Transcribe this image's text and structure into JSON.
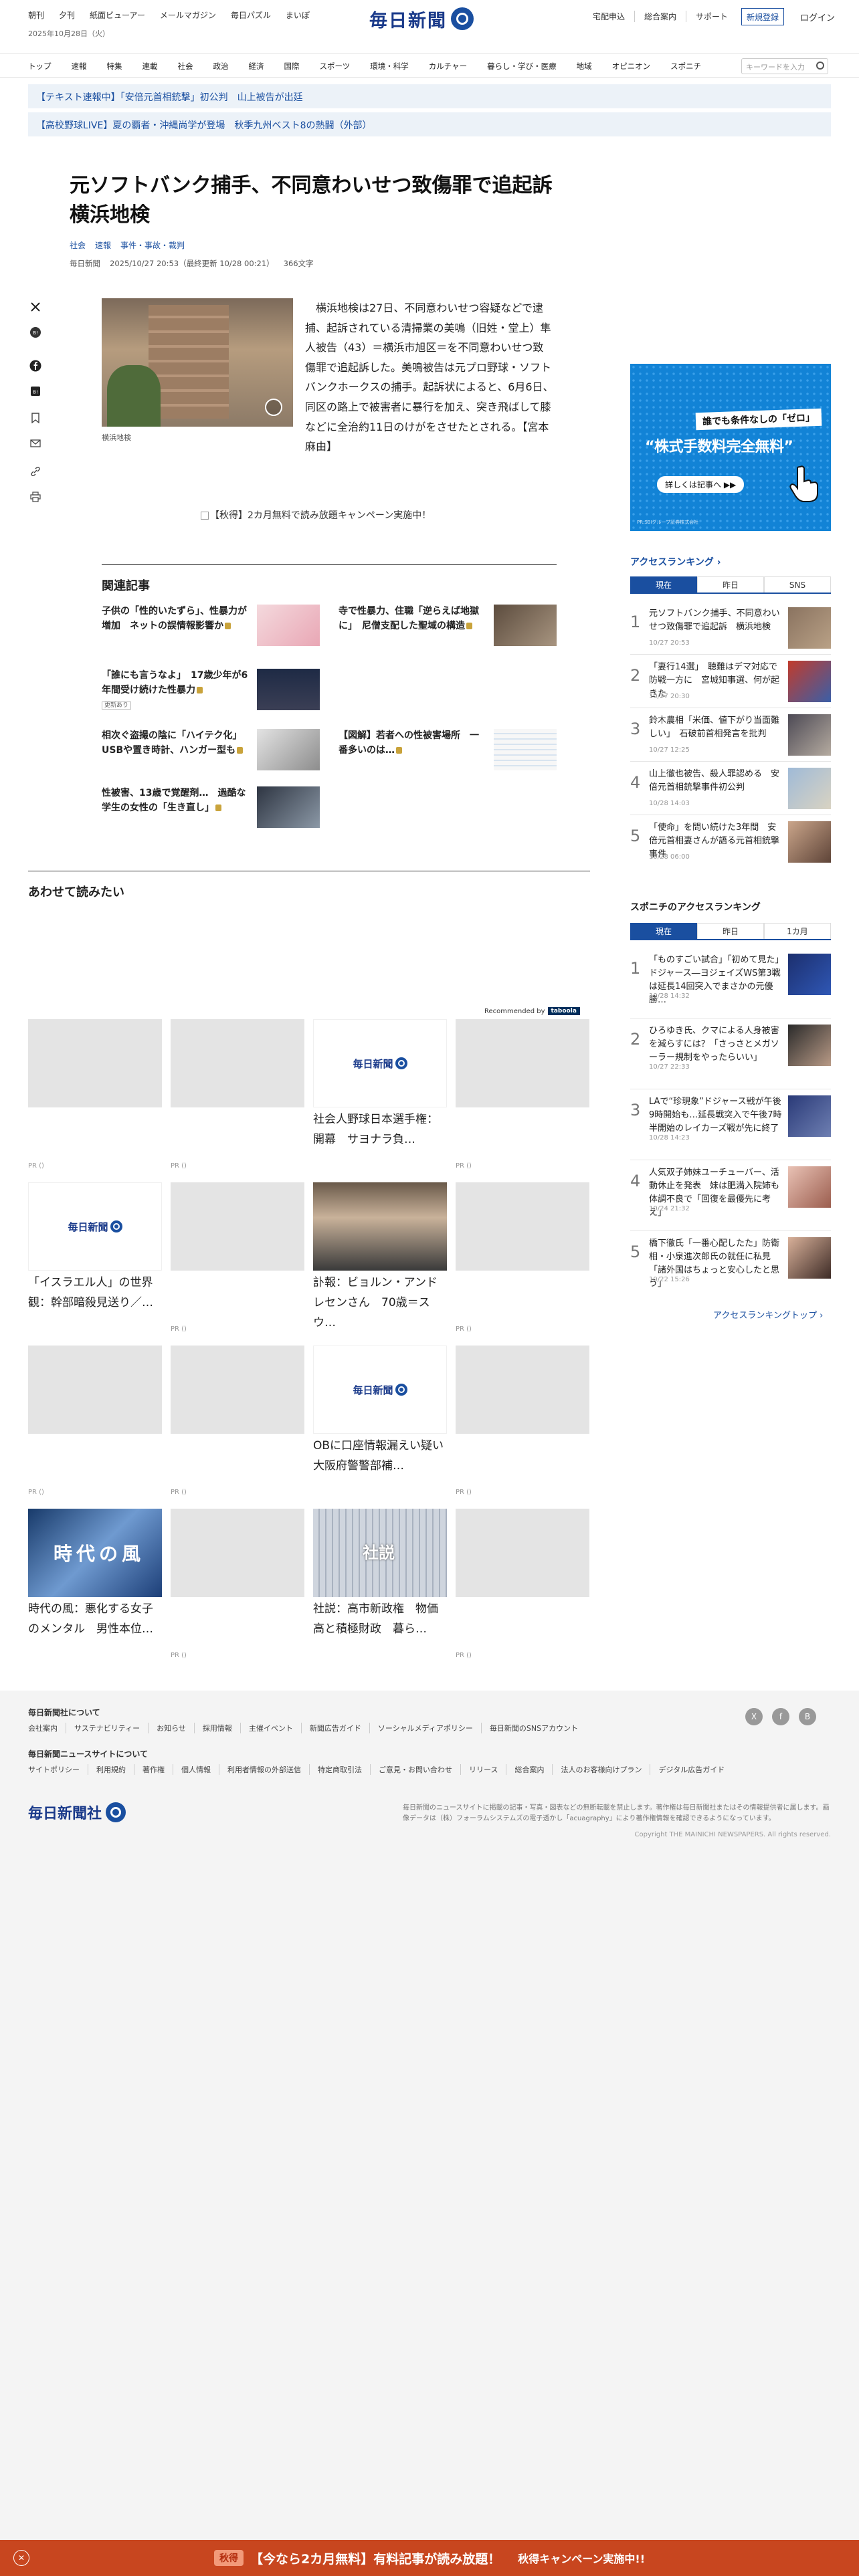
{
  "header": {
    "top_links": [
      "朝刊",
      "夕刊",
      "紙面ビューアー",
      "メールマガジン",
      "毎日パズル",
      "まいぽ"
    ],
    "date": "2025年10月28日（火）",
    "logo_text": "毎日新聞",
    "right_links": [
      "宅配申込",
      "総合案内",
      "サポート"
    ],
    "register_label": "新規登録",
    "login_label": "ログイン"
  },
  "nav": {
    "items": [
      "トップ",
      "速報",
      "特集",
      "連載",
      "社会",
      "政治",
      "経済",
      "国際",
      "スポーツ",
      "環境・科学",
      "カルチャー",
      "暮らし・学び・医療",
      "地域",
      "オピニオン",
      "スポニチ"
    ],
    "search_placeholder": "キーワードを入力"
  },
  "breaking": [
    "【テキスト速報中】「安倍元首相銃撃」初公判　山上被告が出廷",
    "【高校野球LIVE】夏の覇者・沖縄尚学が登場　秋季九州ベスト8の熱闘（外部）"
  ],
  "article": {
    "headline": "元ソフトバンク捕手、不同意わいせつ致傷罪で追起訴　横浜地検",
    "categories": [
      "社会",
      "速報",
      "事件・事故・裁判"
    ],
    "source": "毎日新聞",
    "datetime": "2025/10/27 20:53（最終更新 10/28 00:21）",
    "char_count": "366文字",
    "photo_caption": "横浜地検",
    "body": "横浜地検は27日、不同意わいせつ容疑などで逮捕、起訴されている清掃業の美鳴（旧姓・堂上）隼人被告（43）＝横浜市旭区＝を不同意わいせつ致傷罪で追起訴した。美鳴被告は元プロ野球・ソフトバンクホークスの捕手。起訴状によると、6月6日、同区の路上で被害者に暴行を加え、突き飛ばして膝などに全治約11日のけがをさせたとされる。【宮本麻由】",
    "campaign_text": "【秋得】2カ月無料で読み放題キャンペーン実施中！"
  },
  "related": {
    "title": "関連記事",
    "items": [
      {
        "text": "子供の「性的いたずら」、性暴力が増加　ネットの誤情報影響か",
        "badge": ""
      },
      {
        "text": "寺で性暴力、住職「逆らえば地獄に」　尼僧支配した聖域の構造",
        "badge": ""
      },
      {
        "text": "「誰にも言うなよ」　17歳少年が6年間受け続けた性暴力",
        "badge": "更新あり"
      },
      {
        "text": "相次ぐ盗撮の陰に「ハイテク化」　USBや置き時計、ハンガー型も",
        "badge": ""
      },
      {
        "text": "【図解】若者への性被害場所　一番多いのは…",
        "badge": ""
      },
      {
        "text": "性被害、13歳で覚醒剤…　過酷な学生の女性の「生き直し」",
        "badge": ""
      }
    ]
  },
  "recommend": {
    "title": "あわせて読みたい",
    "recommended_by": "Recommended by",
    "taboola": "taboola",
    "pr_label": "PR ()",
    "cards": [
      {
        "text": "",
        "kind": "blank",
        "pr": true
      },
      {
        "text": "",
        "kind": "blank",
        "pr": true
      },
      {
        "text": "社会人野球日本選手権：開幕　サヨナラ負…",
        "kind": "logo",
        "pr": false
      },
      {
        "text": "",
        "kind": "blank",
        "pr": true
      },
      {
        "text": "「イスラエル人」の世界観：幹部暗殺見送り／…",
        "kind": "logo",
        "pr": false
      },
      {
        "text": "",
        "kind": "blank",
        "pr": true
      },
      {
        "text": "訃報：ビョルン・アンドレセンさん　70歳＝スウ…",
        "kind": "photo",
        "pr": false
      },
      {
        "text": "",
        "kind": "blank",
        "pr": true
      },
      {
        "text": "",
        "kind": "blank",
        "pr": true
      },
      {
        "text": "",
        "kind": "blank",
        "pr": true
      },
      {
        "text": "OBに口座情報漏えい疑い　大阪府警警部補…",
        "kind": "logo",
        "pr": false
      },
      {
        "text": "",
        "kind": "blank",
        "pr": true
      },
      {
        "text": "時代の風：悪化する女子のメンタル　男性本位…",
        "kind": "jidai",
        "pr": false
      },
      {
        "text": "",
        "kind": "blank",
        "pr": true
      },
      {
        "text": "社説：高市新政権　物価高と積極財政　暮ら…",
        "kind": "shasetsu",
        "pr": false
      },
      {
        "text": "",
        "kind": "blank",
        "pr": true
      }
    ],
    "jidai_text": "時代の風",
    "shasetsu_text": "社説"
  },
  "sidebar": {
    "ad": {
      "line1": "誰でも条件なしの「ゼロ」",
      "line2": "“株式手数料完全無料”",
      "line3": "詳しくは記事へ ▶▶",
      "line4": "PR:SBIグループ証券株式会社"
    },
    "access_ranking_title": "アクセスランキング",
    "access_tabs": [
      "現在",
      "昨日",
      "SNS"
    ],
    "access_items": [
      {
        "rank": "1",
        "text": "元ソフトバンク捕手、不同意わいせつ致傷罪で追起訴　横浜地検",
        "date": "10/27 20:53"
      },
      {
        "rank": "2",
        "text": "「妻行14選」　聴難はデマ対応で防戦一方に　宮城知事選、何が起きた",
        "date": "10/27 20:30"
      },
      {
        "rank": "3",
        "text": "鈴木農相「米価、値下がり当面難しい」　石破前首相発言を批判",
        "date": "10/27 12:25"
      },
      {
        "rank": "4",
        "text": "山上徹也被告、殺人罪認める　安倍元首相銃撃事件初公判",
        "date": "10/28 14:03"
      },
      {
        "rank": "5",
        "text": "「使命」を問い続けた3年間　安倍元首相妻さんが語る元首相銃撃事件",
        "date": "10/28 06:00"
      }
    ],
    "sponichi_title": "スポニチのアクセスランキング",
    "sponichi_tabs": [
      "現在",
      "昨日",
      "1カ月"
    ],
    "sponichi_items": [
      {
        "rank": "1",
        "text": "「ものすごい試合」「初めて見た」ドジャース―ヨジェイズWS第3戦は延長14回突入でまさかの元優勝…",
        "date": "10/28 14:32"
      },
      {
        "rank": "2",
        "text": "ひろゆき氏、クマによる人身被害を減らすには？「さっさとメガソーラー規制をやったらいい」",
        "date": "10/27 22:33"
      },
      {
        "rank": "3",
        "text": "LAで“珍現象”ドジャース戦が午後9時開始も…延長戦突入で午後7時半開始のレイカーズ戦が先に終了",
        "date": "10/28 14:23"
      },
      {
        "rank": "4",
        "text": "人気双子姉妹ユーチューバー、活動休止を発表　妹は肥満入院姉も体調不良で「回復を最優先に考え」",
        "date": "10/24 21:32"
      },
      {
        "rank": "5",
        "text": "橋下徹氏「一番心配したた」防衛相・小泉進次郎氏の就任に私見「諸外国はちょっと安心したと思う」",
        "date": "10/22 15:26"
      }
    ],
    "ranking_top_link": "アクセスランキングトップ"
  },
  "footer": {
    "about_title": "毎日新聞社について",
    "about_links": [
      "会社案内",
      "サステナビリティー",
      "お知らせ",
      "採用情報",
      "主催イベント",
      "新聞広告ガイド",
      "ソーシャルメディアポリシー",
      "毎日新聞のSNSアカウント"
    ],
    "site_title": "毎日新聞ニュースサイトについて",
    "site_links": [
      "サイトポリシー",
      "利用規約",
      "著作権",
      "個人情報",
      "利用者情報の外部送信",
      "特定商取引法",
      "ご意見・お問い合わせ",
      "リリース",
      "総合案内",
      "法人のお客様向けプラン",
      "デジタル広告ガイド"
    ],
    "logo_text": "毎日新聞社",
    "note": "毎日新聞のニュースサイトに掲載の記事・写真・図表などの無断転載を禁止します。著作権は毎日新聞社またはその情報提供者に属します。画像データは（株）フォーラムシステムズの電子透かし「acuagraphy」により著作権情報を確認できるようになっています。",
    "copyright": "Copyright THE MAINICHI NEWSPAPERS. All rights reserved."
  },
  "banner": {
    "pill": "秋得",
    "text": "【今なら2カ月無料】有料記事が読み放題！",
    "sub": "秋得キャンペーン実施中!!"
  },
  "colors": {
    "brand": "#1a4fa0",
    "banner": "#c8461f"
  }
}
